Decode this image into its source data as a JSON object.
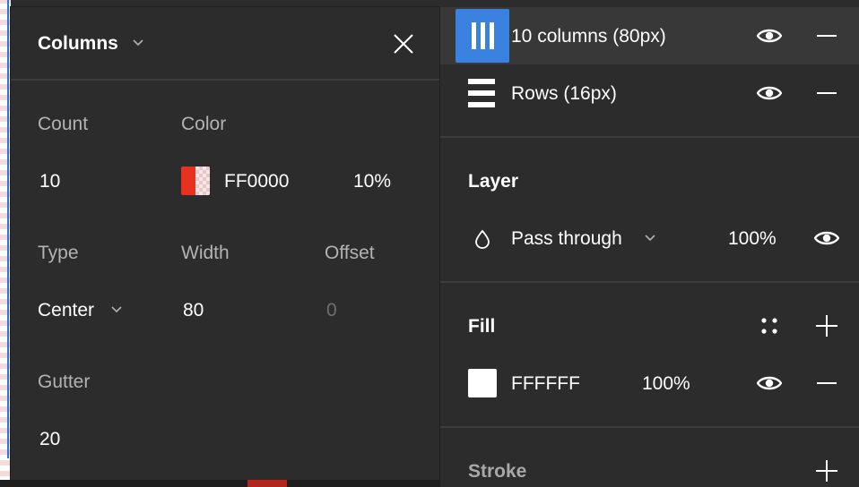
{
  "popover": {
    "title": "Columns",
    "count_label": "Count",
    "count_value": "10",
    "color_label": "Color",
    "color_hex": "FF0000",
    "color_opacity": "10%",
    "type_label": "Type",
    "type_value": "Center",
    "width_label": "Width",
    "width_value": "80",
    "offset_label": "Offset",
    "offset_value": "0",
    "gutter_label": "Gutter",
    "gutter_value": "20",
    "swatch_color": "#FF0000"
  },
  "layout_grids": {
    "items": [
      {
        "label": "10 columns (80px)",
        "icon": "columns-grid-icon",
        "selected": true
      },
      {
        "label": "Rows (16px)",
        "icon": "rows-grid-icon",
        "selected": false
      }
    ]
  },
  "layer": {
    "title": "Layer",
    "blend_mode": "Pass through",
    "opacity": "100%"
  },
  "fill": {
    "title": "Fill",
    "hex": "FFFFFF",
    "opacity": "100%",
    "swatch_color": "#FFFFFF"
  },
  "stroke": {
    "title": "Stroke"
  },
  "colors": {
    "panel_bg": "#2C2C2C",
    "accent": "#3B82E0",
    "selected_row": "#383838"
  }
}
